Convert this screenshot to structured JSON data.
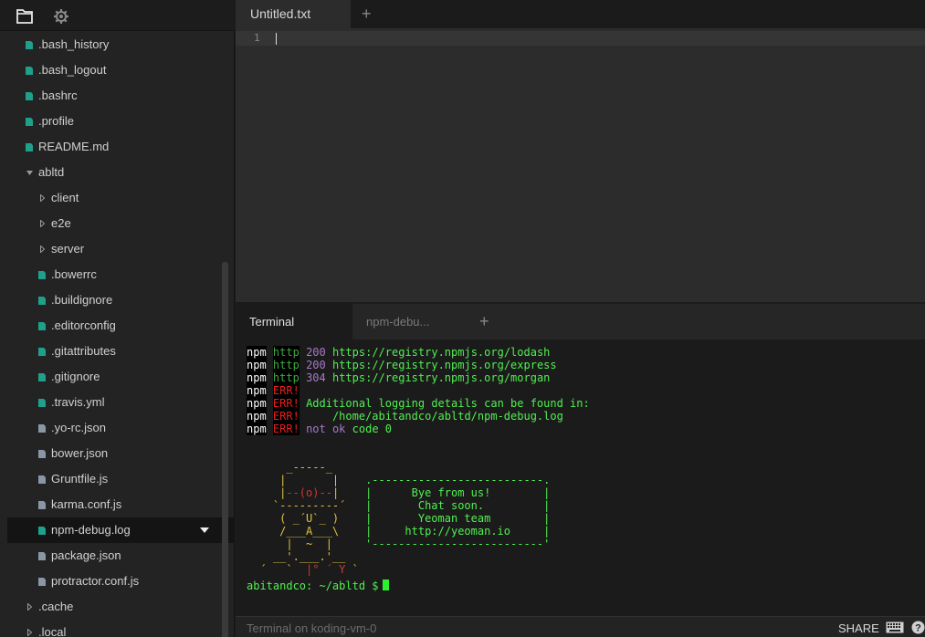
{
  "sidebar": {
    "items": [
      {
        "label": ".bash_history",
        "kind": "file",
        "color": "#1fa08a",
        "depth": 0
      },
      {
        "label": ".bash_logout",
        "kind": "file",
        "color": "#1fa08a",
        "depth": 0
      },
      {
        "label": ".bashrc",
        "kind": "file",
        "color": "#1fa08a",
        "depth": 0
      },
      {
        "label": ".profile",
        "kind": "file",
        "color": "#1fa08a",
        "depth": 0
      },
      {
        "label": "README.md",
        "kind": "file",
        "color": "#1fa08a",
        "depth": 0
      },
      {
        "label": "abltd",
        "kind": "folder-open",
        "depth": 0
      },
      {
        "label": "client",
        "kind": "folder",
        "depth": 1
      },
      {
        "label": "e2e",
        "kind": "folder",
        "depth": 1
      },
      {
        "label": "server",
        "kind": "folder",
        "depth": 1
      },
      {
        "label": ".bowerrc",
        "kind": "file",
        "color": "#1fa08a",
        "depth": 1
      },
      {
        "label": ".buildignore",
        "kind": "file",
        "color": "#1fa08a",
        "depth": 1
      },
      {
        "label": ".editorconfig",
        "kind": "file",
        "color": "#1fa08a",
        "depth": 1
      },
      {
        "label": ".gitattributes",
        "kind": "file",
        "color": "#1fa08a",
        "depth": 1
      },
      {
        "label": ".gitignore",
        "kind": "file",
        "color": "#1fa08a",
        "depth": 1
      },
      {
        "label": ".travis.yml",
        "kind": "file",
        "color": "#1fa08a",
        "depth": 1
      },
      {
        "label": ".yo-rc.json",
        "kind": "file",
        "color": "#8a95a6",
        "depth": 1
      },
      {
        "label": "bower.json",
        "kind": "file",
        "color": "#8a95a6",
        "depth": 1
      },
      {
        "label": "Gruntfile.js",
        "kind": "file",
        "color": "#8a95a6",
        "depth": 1
      },
      {
        "label": "karma.conf.js",
        "kind": "file",
        "color": "#8a95a6",
        "depth": 1
      },
      {
        "label": "npm-debug.log",
        "kind": "file",
        "color": "#1fa08a",
        "depth": 1,
        "selected": true
      },
      {
        "label": "package.json",
        "kind": "file",
        "color": "#8a95a6",
        "depth": 1
      },
      {
        "label": "protractor.conf.js",
        "kind": "file",
        "color": "#8a95a6",
        "depth": 1
      },
      {
        "label": ".cache",
        "kind": "folder",
        "depth": 0
      },
      {
        "label": ".local",
        "kind": "folder",
        "depth": 0
      }
    ]
  },
  "editor": {
    "tab_label": "Untitled.txt",
    "line_number": "1"
  },
  "terminal": {
    "tabs": [
      "Terminal",
      "npm-debu..."
    ],
    "prompt": "abitandco: ~/abltd $",
    "status": "Terminal on koding-vm-0",
    "share_label": "SHARE"
  },
  "colors": {
    "teal_file": "#1fa08a",
    "gray_file": "#8a95a6",
    "terminal_green": "#50f050"
  }
}
